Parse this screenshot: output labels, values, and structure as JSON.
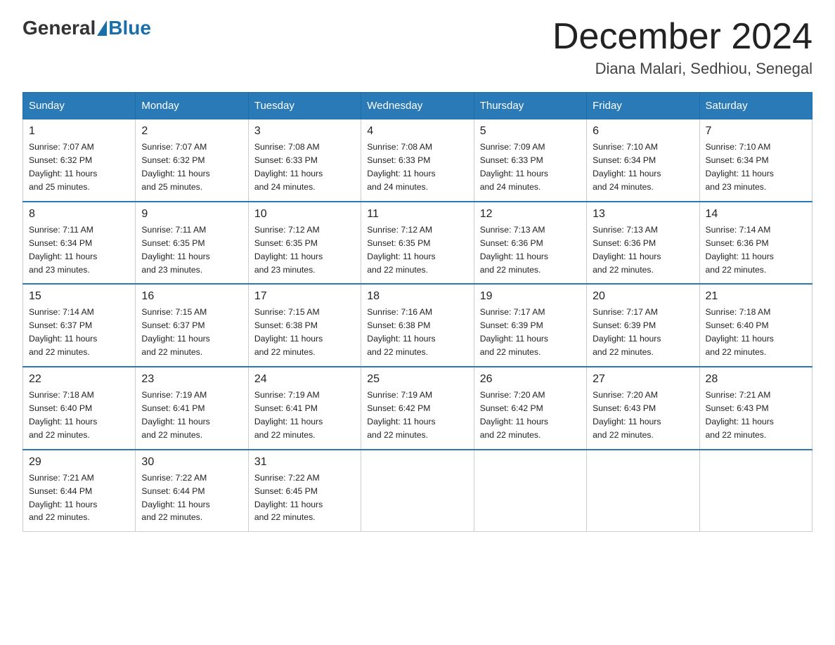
{
  "header": {
    "logo_general": "General",
    "logo_blue": "Blue",
    "month_title": "December 2024",
    "location": "Diana Malari, Sedhiou, Senegal"
  },
  "weekdays": [
    "Sunday",
    "Monday",
    "Tuesday",
    "Wednesday",
    "Thursday",
    "Friday",
    "Saturday"
  ],
  "weeks": [
    [
      {
        "day": "1",
        "sunrise": "7:07 AM",
        "sunset": "6:32 PM",
        "daylight": "11 hours and 25 minutes."
      },
      {
        "day": "2",
        "sunrise": "7:07 AM",
        "sunset": "6:32 PM",
        "daylight": "11 hours and 25 minutes."
      },
      {
        "day": "3",
        "sunrise": "7:08 AM",
        "sunset": "6:33 PM",
        "daylight": "11 hours and 24 minutes."
      },
      {
        "day": "4",
        "sunrise": "7:08 AM",
        "sunset": "6:33 PM",
        "daylight": "11 hours and 24 minutes."
      },
      {
        "day": "5",
        "sunrise": "7:09 AM",
        "sunset": "6:33 PM",
        "daylight": "11 hours and 24 minutes."
      },
      {
        "day": "6",
        "sunrise": "7:10 AM",
        "sunset": "6:34 PM",
        "daylight": "11 hours and 24 minutes."
      },
      {
        "day": "7",
        "sunrise": "7:10 AM",
        "sunset": "6:34 PM",
        "daylight": "11 hours and 23 minutes."
      }
    ],
    [
      {
        "day": "8",
        "sunrise": "7:11 AM",
        "sunset": "6:34 PM",
        "daylight": "11 hours and 23 minutes."
      },
      {
        "day": "9",
        "sunrise": "7:11 AM",
        "sunset": "6:35 PM",
        "daylight": "11 hours and 23 minutes."
      },
      {
        "day": "10",
        "sunrise": "7:12 AM",
        "sunset": "6:35 PM",
        "daylight": "11 hours and 23 minutes."
      },
      {
        "day": "11",
        "sunrise": "7:12 AM",
        "sunset": "6:35 PM",
        "daylight": "11 hours and 22 minutes."
      },
      {
        "day": "12",
        "sunrise": "7:13 AM",
        "sunset": "6:36 PM",
        "daylight": "11 hours and 22 minutes."
      },
      {
        "day": "13",
        "sunrise": "7:13 AM",
        "sunset": "6:36 PM",
        "daylight": "11 hours and 22 minutes."
      },
      {
        "day": "14",
        "sunrise": "7:14 AM",
        "sunset": "6:36 PM",
        "daylight": "11 hours and 22 minutes."
      }
    ],
    [
      {
        "day": "15",
        "sunrise": "7:14 AM",
        "sunset": "6:37 PM",
        "daylight": "11 hours and 22 minutes."
      },
      {
        "day": "16",
        "sunrise": "7:15 AM",
        "sunset": "6:37 PM",
        "daylight": "11 hours and 22 minutes."
      },
      {
        "day": "17",
        "sunrise": "7:15 AM",
        "sunset": "6:38 PM",
        "daylight": "11 hours and 22 minutes."
      },
      {
        "day": "18",
        "sunrise": "7:16 AM",
        "sunset": "6:38 PM",
        "daylight": "11 hours and 22 minutes."
      },
      {
        "day": "19",
        "sunrise": "7:17 AM",
        "sunset": "6:39 PM",
        "daylight": "11 hours and 22 minutes."
      },
      {
        "day": "20",
        "sunrise": "7:17 AM",
        "sunset": "6:39 PM",
        "daylight": "11 hours and 22 minutes."
      },
      {
        "day": "21",
        "sunrise": "7:18 AM",
        "sunset": "6:40 PM",
        "daylight": "11 hours and 22 minutes."
      }
    ],
    [
      {
        "day": "22",
        "sunrise": "7:18 AM",
        "sunset": "6:40 PM",
        "daylight": "11 hours and 22 minutes."
      },
      {
        "day": "23",
        "sunrise": "7:19 AM",
        "sunset": "6:41 PM",
        "daylight": "11 hours and 22 minutes."
      },
      {
        "day": "24",
        "sunrise": "7:19 AM",
        "sunset": "6:41 PM",
        "daylight": "11 hours and 22 minutes."
      },
      {
        "day": "25",
        "sunrise": "7:19 AM",
        "sunset": "6:42 PM",
        "daylight": "11 hours and 22 minutes."
      },
      {
        "day": "26",
        "sunrise": "7:20 AM",
        "sunset": "6:42 PM",
        "daylight": "11 hours and 22 minutes."
      },
      {
        "day": "27",
        "sunrise": "7:20 AM",
        "sunset": "6:43 PM",
        "daylight": "11 hours and 22 minutes."
      },
      {
        "day": "28",
        "sunrise": "7:21 AM",
        "sunset": "6:43 PM",
        "daylight": "11 hours and 22 minutes."
      }
    ],
    [
      {
        "day": "29",
        "sunrise": "7:21 AM",
        "sunset": "6:44 PM",
        "daylight": "11 hours and 22 minutes."
      },
      {
        "day": "30",
        "sunrise": "7:22 AM",
        "sunset": "6:44 PM",
        "daylight": "11 hours and 22 minutes."
      },
      {
        "day": "31",
        "sunrise": "7:22 AM",
        "sunset": "6:45 PM",
        "daylight": "11 hours and 22 minutes."
      },
      null,
      null,
      null,
      null
    ]
  ],
  "labels": {
    "sunrise": "Sunrise:",
    "sunset": "Sunset:",
    "daylight": "Daylight:"
  }
}
